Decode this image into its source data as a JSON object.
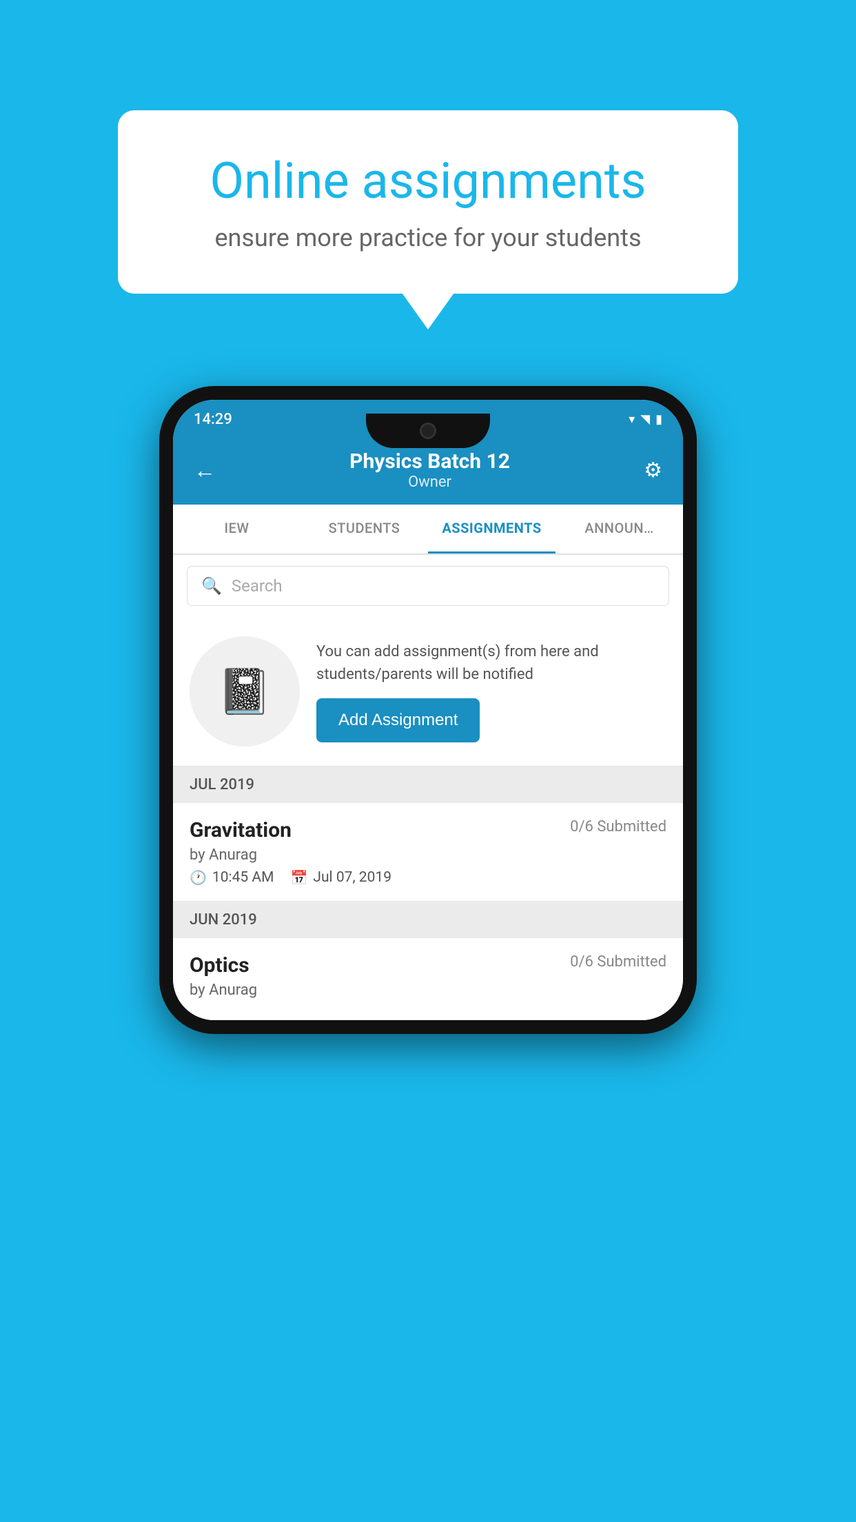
{
  "background_color": "#1ab7ea",
  "speech_bubble": {
    "title": "Online assignments",
    "subtitle": "ensure more practice for your students"
  },
  "phone": {
    "status_bar": {
      "time": "14:29",
      "wifi": "▾",
      "signal": "▲",
      "battery": "▮"
    },
    "header": {
      "title": "Physics Batch 12",
      "subtitle": "Owner",
      "back_label": "←",
      "settings_label": "⚙"
    },
    "tabs": [
      {
        "label": "IEW",
        "active": false
      },
      {
        "label": "STUDENTS",
        "active": false
      },
      {
        "label": "ASSIGNMENTS",
        "active": true
      },
      {
        "label": "ANNOUNCEMENTS",
        "active": false
      }
    ],
    "search": {
      "placeholder": "Search"
    },
    "promo": {
      "text": "You can add assignment(s) from here and students/parents will be notified",
      "button_label": "Add Assignment"
    },
    "sections": [
      {
        "label": "JUL 2019",
        "assignments": [
          {
            "name": "Gravitation",
            "submitted": "0/6 Submitted",
            "by": "by Anurag",
            "time": "10:45 AM",
            "date": "Jul 07, 2019"
          }
        ]
      },
      {
        "label": "JUN 2019",
        "assignments": [
          {
            "name": "Optics",
            "submitted": "0/6 Submitted",
            "by": "by Anurag",
            "time": "",
            "date": ""
          }
        ]
      }
    ]
  }
}
